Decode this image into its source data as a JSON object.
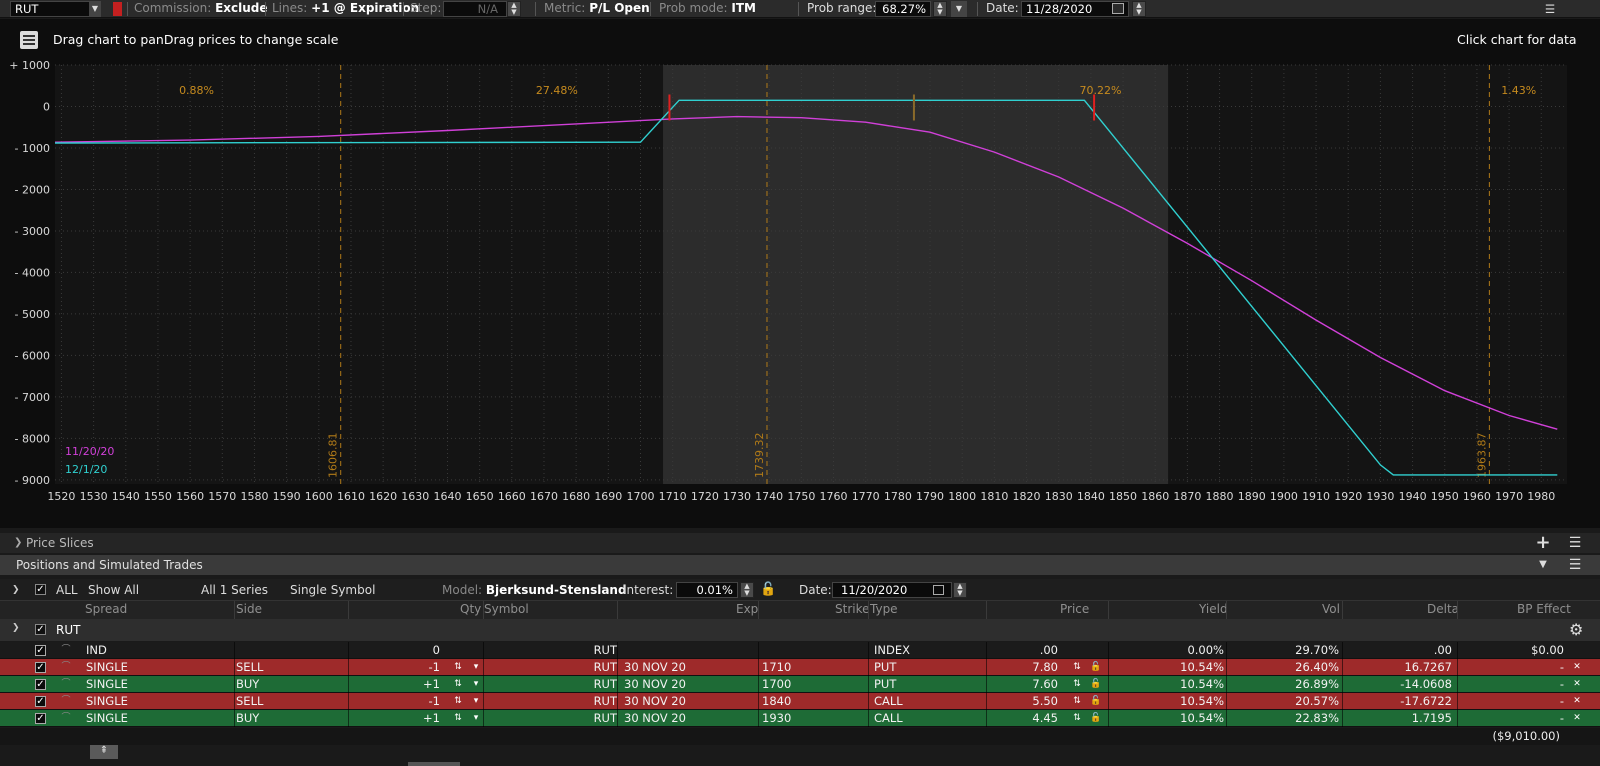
{
  "toolbar": {
    "symbol": "RUT",
    "commission_label": "Commission:",
    "commission_value": "Exclude",
    "lines_label": "Lines:",
    "lines_value": "+1 @ Expiration",
    "step_label": "Step:",
    "step_value": "N/A",
    "metric_label": "Metric:",
    "metric_value": "P/L Open",
    "prob_mode_label": "Prob mode:",
    "prob_mode_value": "ITM",
    "prob_range_label": "Prob range:",
    "prob_range_value": "68.27%",
    "date_label": "Date:",
    "date_value": "11/28/2020"
  },
  "chart_hints": {
    "drag_text": "Drag chart to panDrag prices to change scale",
    "click_text": "Click chart for data"
  },
  "chart_data": {
    "type": "line",
    "xlim": [
      1518,
      1988
    ],
    "ylim": [
      -9100,
      1000
    ],
    "x_ticks": [
      1520,
      1530,
      1540,
      1550,
      1560,
      1570,
      1580,
      1590,
      1600,
      1610,
      1620,
      1630,
      1640,
      1650,
      1660,
      1670,
      1680,
      1690,
      1700,
      1710,
      1720,
      1730,
      1740,
      1750,
      1760,
      1770,
      1780,
      1790,
      1800,
      1810,
      1820,
      1830,
      1840,
      1850,
      1860,
      1870,
      1880,
      1890,
      1900,
      1910,
      1920,
      1930,
      1940,
      1950,
      1960,
      1970,
      1980
    ],
    "y_ticks": [
      {
        "value": 1000,
        "label": "+ 1000"
      },
      {
        "value": 0,
        "label": "0"
      },
      {
        "value": -1000,
        "label": "- 1000"
      },
      {
        "value": -2000,
        "label": "- 2000"
      },
      {
        "value": -3000,
        "label": "- 3000"
      },
      {
        "value": -4000,
        "label": "- 4000"
      },
      {
        "value": -5000,
        "label": "- 5000"
      },
      {
        "value": -6000,
        "label": "- 6000"
      },
      {
        "value": -7000,
        "label": "- 7000"
      },
      {
        "value": -8000,
        "label": "- 8000"
      },
      {
        "value": -9000,
        "label": "- 9000"
      }
    ],
    "prob_band": [
      1707,
      1864
    ],
    "prob_labels": [
      {
        "x": 1562,
        "text": "0.88%"
      },
      {
        "x": 1674,
        "text": "27.48%"
      },
      {
        "x": 1843,
        "text": "70.22%"
      },
      {
        "x": 1973,
        "text": "1.43%"
      }
    ],
    "vlines": [
      {
        "x": 1606.81,
        "label": "1606.81"
      },
      {
        "x": 1739.32,
        "label": "1739.32"
      },
      {
        "x": 1963.87,
        "label": "1963.87"
      }
    ],
    "markers": [
      {
        "x": 1709,
        "color": "#e02020"
      },
      {
        "x": 1785,
        "color": "#8a6a2a"
      },
      {
        "x": 1841,
        "color": "#e02020"
      }
    ],
    "series": [
      {
        "name": "11/20/20",
        "color": "#d040d8",
        "x": [
          1518,
          1560,
          1600,
          1640,
          1680,
          1710,
          1730,
          1750,
          1770,
          1790,
          1810,
          1830,
          1850,
          1870,
          1890,
          1910,
          1930,
          1950,
          1970,
          1985
        ],
        "y": [
          -860,
          -810,
          -720,
          -580,
          -420,
          -300,
          -245,
          -270,
          -380,
          -620,
          -1100,
          -1700,
          -2450,
          -3300,
          -4200,
          -5150,
          -6050,
          -6850,
          -7450,
          -7780
        ]
      },
      {
        "name": "12/1/20",
        "color": "#30d0d0",
        "x": [
          1518,
          1700,
          1712,
          1838,
          1930,
          1934,
          1985
        ],
        "y": [
          -880,
          -860,
          150,
          150,
          -8640,
          -8880,
          -8880
        ]
      }
    ]
  },
  "price_slices_label": "Price Slices",
  "positions_label": "Positions and Simulated Trades",
  "filters": {
    "all_label": "ALL",
    "show_all": "Show All",
    "series": "All 1 Series",
    "symbol_mode": "Single Symbol",
    "model_label": "Model:",
    "model_value": "Bjerksund-Stensland",
    "interest_label": "Interest:",
    "interest_value": "0.01%",
    "date_label": "Date:",
    "date_value": "11/20/2020"
  },
  "columns": {
    "spread": "Spread",
    "side": "Side",
    "qty": "Qty",
    "symbol": "Symbol",
    "exp": "Exp",
    "strike": "Strike",
    "type": "Type",
    "price": "Price",
    "yield": "Yield",
    "vol": "Vol",
    "delta": "Delta",
    "bp": "BP Effect"
  },
  "group_label": "RUT",
  "rows": [
    {
      "spread": "IND",
      "side": "",
      "qty": "0",
      "symbol": "RUT",
      "exp": "",
      "strike": "",
      "type": "INDEX",
      "price": ".00",
      "yield": "0.00%",
      "vol": "29.70%",
      "delta": ".00",
      "bp": "$0.00",
      "color": "plain",
      "has_controls": false
    },
    {
      "spread": "SINGLE",
      "side": "SELL",
      "qty": "-1",
      "symbol": "RUT",
      "exp": "30 NOV 20",
      "strike": "1710",
      "type": "PUT",
      "price": "7.80",
      "yield": "10.54%",
      "vol": "26.40%",
      "delta": "16.7267",
      "bp": "-",
      "color": "red",
      "has_controls": true
    },
    {
      "spread": "SINGLE",
      "side": "BUY",
      "qty": "+1",
      "symbol": "RUT",
      "exp": "30 NOV 20",
      "strike": "1700",
      "type": "PUT",
      "price": "7.60",
      "yield": "10.54%",
      "vol": "26.89%",
      "delta": "-14.0608",
      "bp": "-",
      "color": "green",
      "has_controls": true
    },
    {
      "spread": "SINGLE",
      "side": "SELL",
      "qty": "-1",
      "symbol": "RUT",
      "exp": "30 NOV 20",
      "strike": "1840",
      "type": "CALL",
      "price": "5.50",
      "yield": "10.54%",
      "vol": "20.57%",
      "delta": "-17.6722",
      "bp": "-",
      "color": "red",
      "has_controls": true
    },
    {
      "spread": "SINGLE",
      "side": "BUY",
      "qty": "+1",
      "symbol": "RUT",
      "exp": "30 NOV 20",
      "strike": "1930",
      "type": "CALL",
      "price": "4.45",
      "yield": "10.54%",
      "vol": "22.83%",
      "delta": "1.7195",
      "bp": "-",
      "color": "green",
      "has_controls": true
    }
  ],
  "total_bp": "($9,010.00)"
}
